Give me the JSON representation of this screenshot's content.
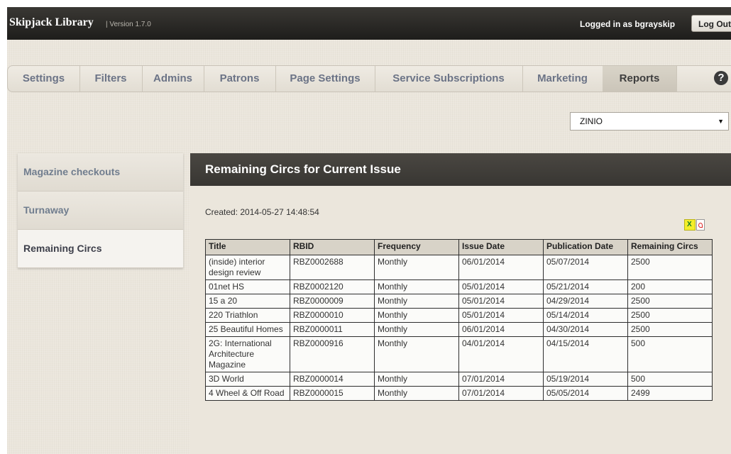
{
  "header": {
    "app_name": "Skipjack Library",
    "version": "| Version 1.7.0",
    "logged_in": "Logged in as bgrayskip",
    "logout_label": "Log Out"
  },
  "tabs": [
    {
      "label": "Settings"
    },
    {
      "label": "Filters"
    },
    {
      "label": "Admins"
    },
    {
      "label": "Patrons"
    },
    {
      "label": "Page Settings"
    },
    {
      "label": "Service Subscriptions"
    },
    {
      "label": "Marketing"
    },
    {
      "label": "Reports",
      "active": true
    }
  ],
  "service_select": {
    "selected": "ZINIO"
  },
  "sidenav": [
    {
      "label": "Magazine checkouts"
    },
    {
      "label": "Turnaway"
    },
    {
      "label": "Remaining Circs",
      "active": true
    }
  ],
  "report": {
    "title": "Remaining Circs for Current Issue",
    "created": "Created: 2014-05-27 14:48:54",
    "columns": [
      "Title",
      "RBID",
      "Frequency",
      "Issue Date",
      "Publication Date",
      "Remaining Circs"
    ],
    "rows": [
      [
        "(inside) interior design review",
        "RBZ0002688",
        "Monthly",
        "06/01/2014",
        "05/07/2014",
        "2500"
      ],
      [
        "01net HS",
        "RBZ0002120",
        "Monthly",
        "05/01/2014",
        "05/21/2014",
        "200"
      ],
      [
        "15 a 20",
        "RBZ0000009",
        "Monthly",
        "05/01/2014",
        "04/29/2014",
        "2500"
      ],
      [
        "220 Triathlon",
        "RBZ0000010",
        "Monthly",
        "05/01/2014",
        "05/14/2014",
        "2500"
      ],
      [
        "25 Beautiful Homes",
        "RBZ0000011",
        "Monthly",
        "06/01/2014",
        "04/30/2014",
        "2500"
      ],
      [
        "2G: International Architecture Magazine",
        "RBZ0000916",
        "Monthly",
        "04/01/2014",
        "04/15/2014",
        "500"
      ],
      [
        "3D World",
        "RBZ0000014",
        "Monthly",
        "07/01/2014",
        "05/19/2014",
        "500"
      ],
      [
        "4 Wheel & Off Road",
        "RBZ0000015",
        "Monthly",
        "07/01/2014",
        "05/05/2014",
        "2499"
      ]
    ]
  },
  "icons": {
    "help": "help-icon",
    "excel": "excel-export-icon",
    "pdf": "pdf-export-icon",
    "dropdown": "chevron-down-icon"
  }
}
